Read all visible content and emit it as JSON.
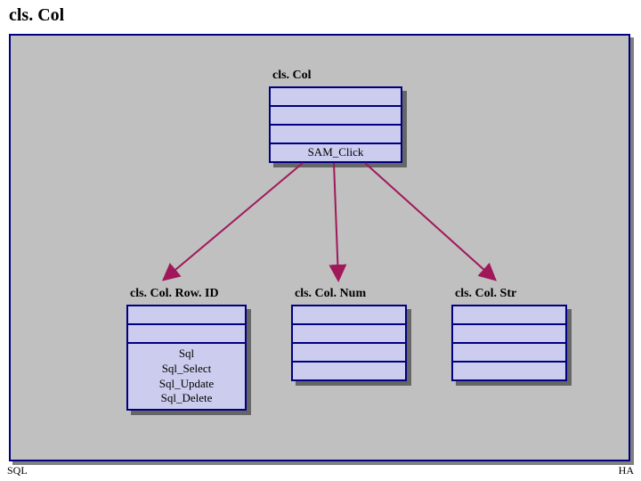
{
  "slide": {
    "title": "cls. Col",
    "footer_left": "SQL",
    "footer_right": "HA"
  },
  "classes": {
    "parent": {
      "name": "cls. Col",
      "method": "SAM_Click"
    },
    "rowid": {
      "name": "cls. Col. Row. ID",
      "op1": "Sql",
      "op2": "Sql_Select",
      "op3": "Sql_Update",
      "op4": "Sql_Delete"
    },
    "num": {
      "name": "cls. Col. Num"
    },
    "str": {
      "name": "cls. Col. Str"
    }
  },
  "chart_data": {
    "type": "diagram",
    "title": "cls. Col",
    "nodes": [
      {
        "id": "clsCol",
        "label": "cls. Col",
        "compartments": [
          "",
          "",
          "",
          "SAM_Click"
        ]
      },
      {
        "id": "clsColRowID",
        "label": "cls. Col. Row. ID",
        "compartments": [
          "",
          "",
          "Sql\nSql_Select\nSql_Update\nSql_Delete"
        ]
      },
      {
        "id": "clsColNum",
        "label": "cls. Col. Num",
        "compartments": [
          "",
          "",
          "",
          ""
        ]
      },
      {
        "id": "clsColStr",
        "label": "cls. Col. Str",
        "compartments": [
          "",
          "",
          "",
          ""
        ]
      }
    ],
    "edges": [
      {
        "from": "clsCol",
        "to": "clsColRowID",
        "style": "arrow"
      },
      {
        "from": "clsCol",
        "to": "clsColNum",
        "style": "arrow"
      },
      {
        "from": "clsCol",
        "to": "clsColStr",
        "style": "arrow"
      }
    ]
  }
}
